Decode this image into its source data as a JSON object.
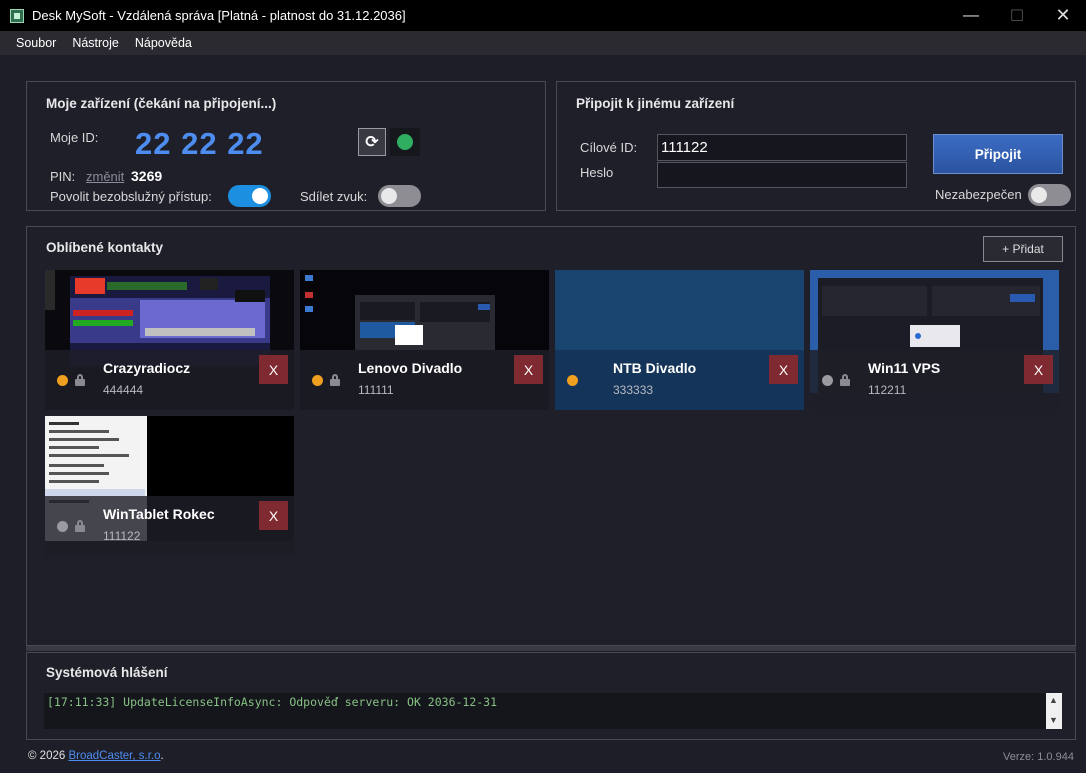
{
  "window": {
    "title": "Desk MySoft - Vzdálená správa [Platná - platnost do 31.12.2036]",
    "minimize": "—",
    "maximize": "☐",
    "close": "✕"
  },
  "menu": [
    "Soubor",
    "Nástroje",
    "Nápověda"
  ],
  "my_device": {
    "title": "Moje zařízení (čekání na připojení...)",
    "id_label": "Moje ID:",
    "id_value": "22 22 22",
    "pin_label": "PIN:",
    "change_link": "změnit",
    "pin_value": "3269",
    "unattended_label": "Povolit bezobslužný přístup:",
    "unattended_on": true,
    "share_sound_label": "Sdílet zvuk:",
    "share_sound_on": false,
    "refresh_icon": "refresh-icon",
    "status_color": "#2fae62"
  },
  "connect": {
    "title": "Připojit k jinému zařízení",
    "target_label": "Cílové ID:",
    "target_value": "111122",
    "password_label": "Heslo",
    "password_value": "",
    "button": "Připojit",
    "insecure_label": "Nezabezpečen",
    "insecure_on": false
  },
  "favorites": {
    "title": "Oblíbené kontakty",
    "add_button": "+ Přidat",
    "contacts": [
      {
        "name": "Crazyradiocz",
        "id": "444444",
        "status_color": "#f0a020",
        "delete": "X"
      },
      {
        "name": "Lenovo Divadlo",
        "id": "111111",
        "status_color": "#f0a020",
        "delete": "X"
      },
      {
        "name": "NTB Divadlo",
        "id": "333333",
        "status_color": "#f0a020",
        "delete": "X"
      },
      {
        "name": "Win11 VPS",
        "id": "112211",
        "status_color": "#9a9aa0",
        "delete": "X"
      },
      {
        "name": "WinTablet Rokec",
        "id": "111122",
        "status_color": "#9a9aa0",
        "delete": "X"
      }
    ]
  },
  "log": {
    "title": "Systémová hlášení",
    "lines": [
      "[17:11:33] UpdateLicenseInfoAsync: Odpověď serveru: OK 2036-12-31"
    ],
    "scroll_up": "▲",
    "scroll_down": "▼"
  },
  "footer": {
    "copyright": "© 2026 ",
    "company": "BroadCaster, s.r.o",
    "dot": ".",
    "version": "Verze: 1.0.944"
  }
}
